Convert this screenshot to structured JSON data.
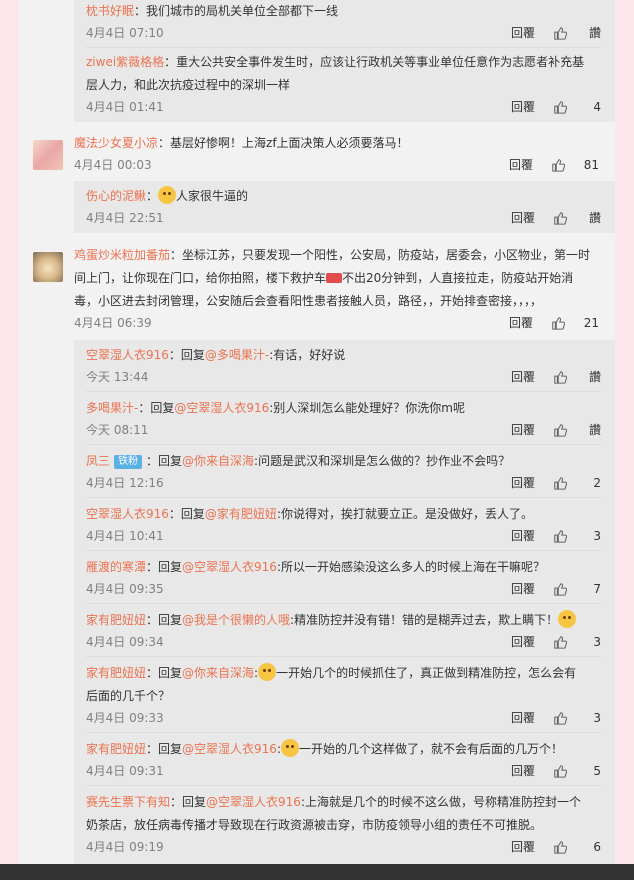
{
  "reply_label": "回覆",
  "like_label": "讚",
  "top_group": {
    "items": [
      {
        "name": "枕书好眠",
        "text": "：我们城市的局机关单位全部都下一线",
        "time": "4月4日 07:10",
        "likes": "讚"
      },
      {
        "name": "ziwei紫薇格格",
        "text": "：重大公共安全事件发生时，应该让行政机关等事业单位任意作为志愿者补充基",
        "text2": "层人力，和此次抗疫过程中的深圳一样",
        "time": "4月4日 01:41",
        "likes": "4"
      }
    ]
  },
  "comment1": {
    "name": "魔法少女夏小凉",
    "text": "：基层好惨啊！上海zf上面决策人必须要落马！",
    "time": "4月4日 00:03",
    "likes": "81"
  },
  "sub1": {
    "name": "伤心的泥鳅",
    "text": "：",
    "text_after": "人家很牛逼的",
    "emoji": "doge-emoji",
    "time": "4月4日 22:51",
    "likes": "讚"
  },
  "comment2": {
    "name": "鸡蛋炒米粒加番茄",
    "line1": "：坐标江苏，只要发现一个阳性，公安局，防疫站，居委会，小区物业，第一时",
    "line2": "间上门，让你现在门口，给你拍照，楼下救护车",
    "line2b": "不出20分钟到，人直接拉走，防疫站开始消",
    "line3": "毒，小区进去封闭管理，公安随后会查看阳性患者接触人员，路径，，开始排查密接，，，，",
    "time": "4月4日 06:39",
    "likes": "21"
  },
  "replies": [
    {
      "name": "空翠湿人衣916",
      "reply": "：回复",
      "mention": "@多喝果汁-",
      "text": ":有话，好好说",
      "time": "今天 13:44",
      "likes": "讚"
    },
    {
      "name": "多喝果汁-",
      "reply": "：回复",
      "mention": "@空翠湿人衣916",
      "text": ":别人深圳怎么能处理好？你洗你m呢",
      "time": "今天 08:11",
      "likes": "讚"
    },
    {
      "name": "凤三",
      "badge": "铁粉",
      "reply": "：回复",
      "mention": "@你来自深海",
      "text": ":问题是武汉和深圳是怎么做的？抄作业不会吗？",
      "time": "4月4日 12:16",
      "likes": "2"
    },
    {
      "name": "空翠湿人衣916",
      "reply": "：回复",
      "mention": "@家有肥妞妞",
      "text": ":你说得对，挨打就要立正。是没做好，丢人了。",
      "time": "4月4日 10:41",
      "likes": "3"
    },
    {
      "name": "雁渡的寒潭",
      "reply": "：回复",
      "mention": "@空翠湿人衣916",
      "text": ":所以一开始感染没这么多人的时候上海在干嘛呢？",
      "time": "4月4日 09:35",
      "likes": "7"
    },
    {
      "name": "家有肥妞妞",
      "reply": "：回复",
      "mention": "@我是个很懒的人哦",
      "text": ":精准防控并没有错！错的是糊弄过去，欺上瞒下！",
      "time": "4月4日 09:34",
      "likes": "3"
    },
    {
      "name": "家有肥妞妞",
      "reply": "：回复",
      "mention": "@你来自深海",
      "text": ":",
      "text_after": "一开始几个的时候抓住了，真正做到精准防控，怎么会有",
      "text2": "后面的几千个？",
      "time": "4月4日 09:33",
      "likes": "3"
    },
    {
      "name": "家有肥妞妞",
      "reply": "：回复",
      "mention": "@空翠湿人衣916",
      "text": ":",
      "text_after": "一开始的几个这样做了，就不会有后面的几万个！",
      "time": "4月4日 09:31",
      "likes": "5"
    },
    {
      "name": "赛先生票下有知",
      "reply": "：回复",
      "mention": "@空翠湿人衣916",
      "text": ":上海就是几个的时候不这么做，号称精准防控封一个",
      "text2": "奶茶店，放任病毒传播才导致现在行政资源被击穿，市防疫领导小组的责任不可推脱。",
      "time": "4月4日 09:19",
      "likes": "6"
    }
  ]
}
